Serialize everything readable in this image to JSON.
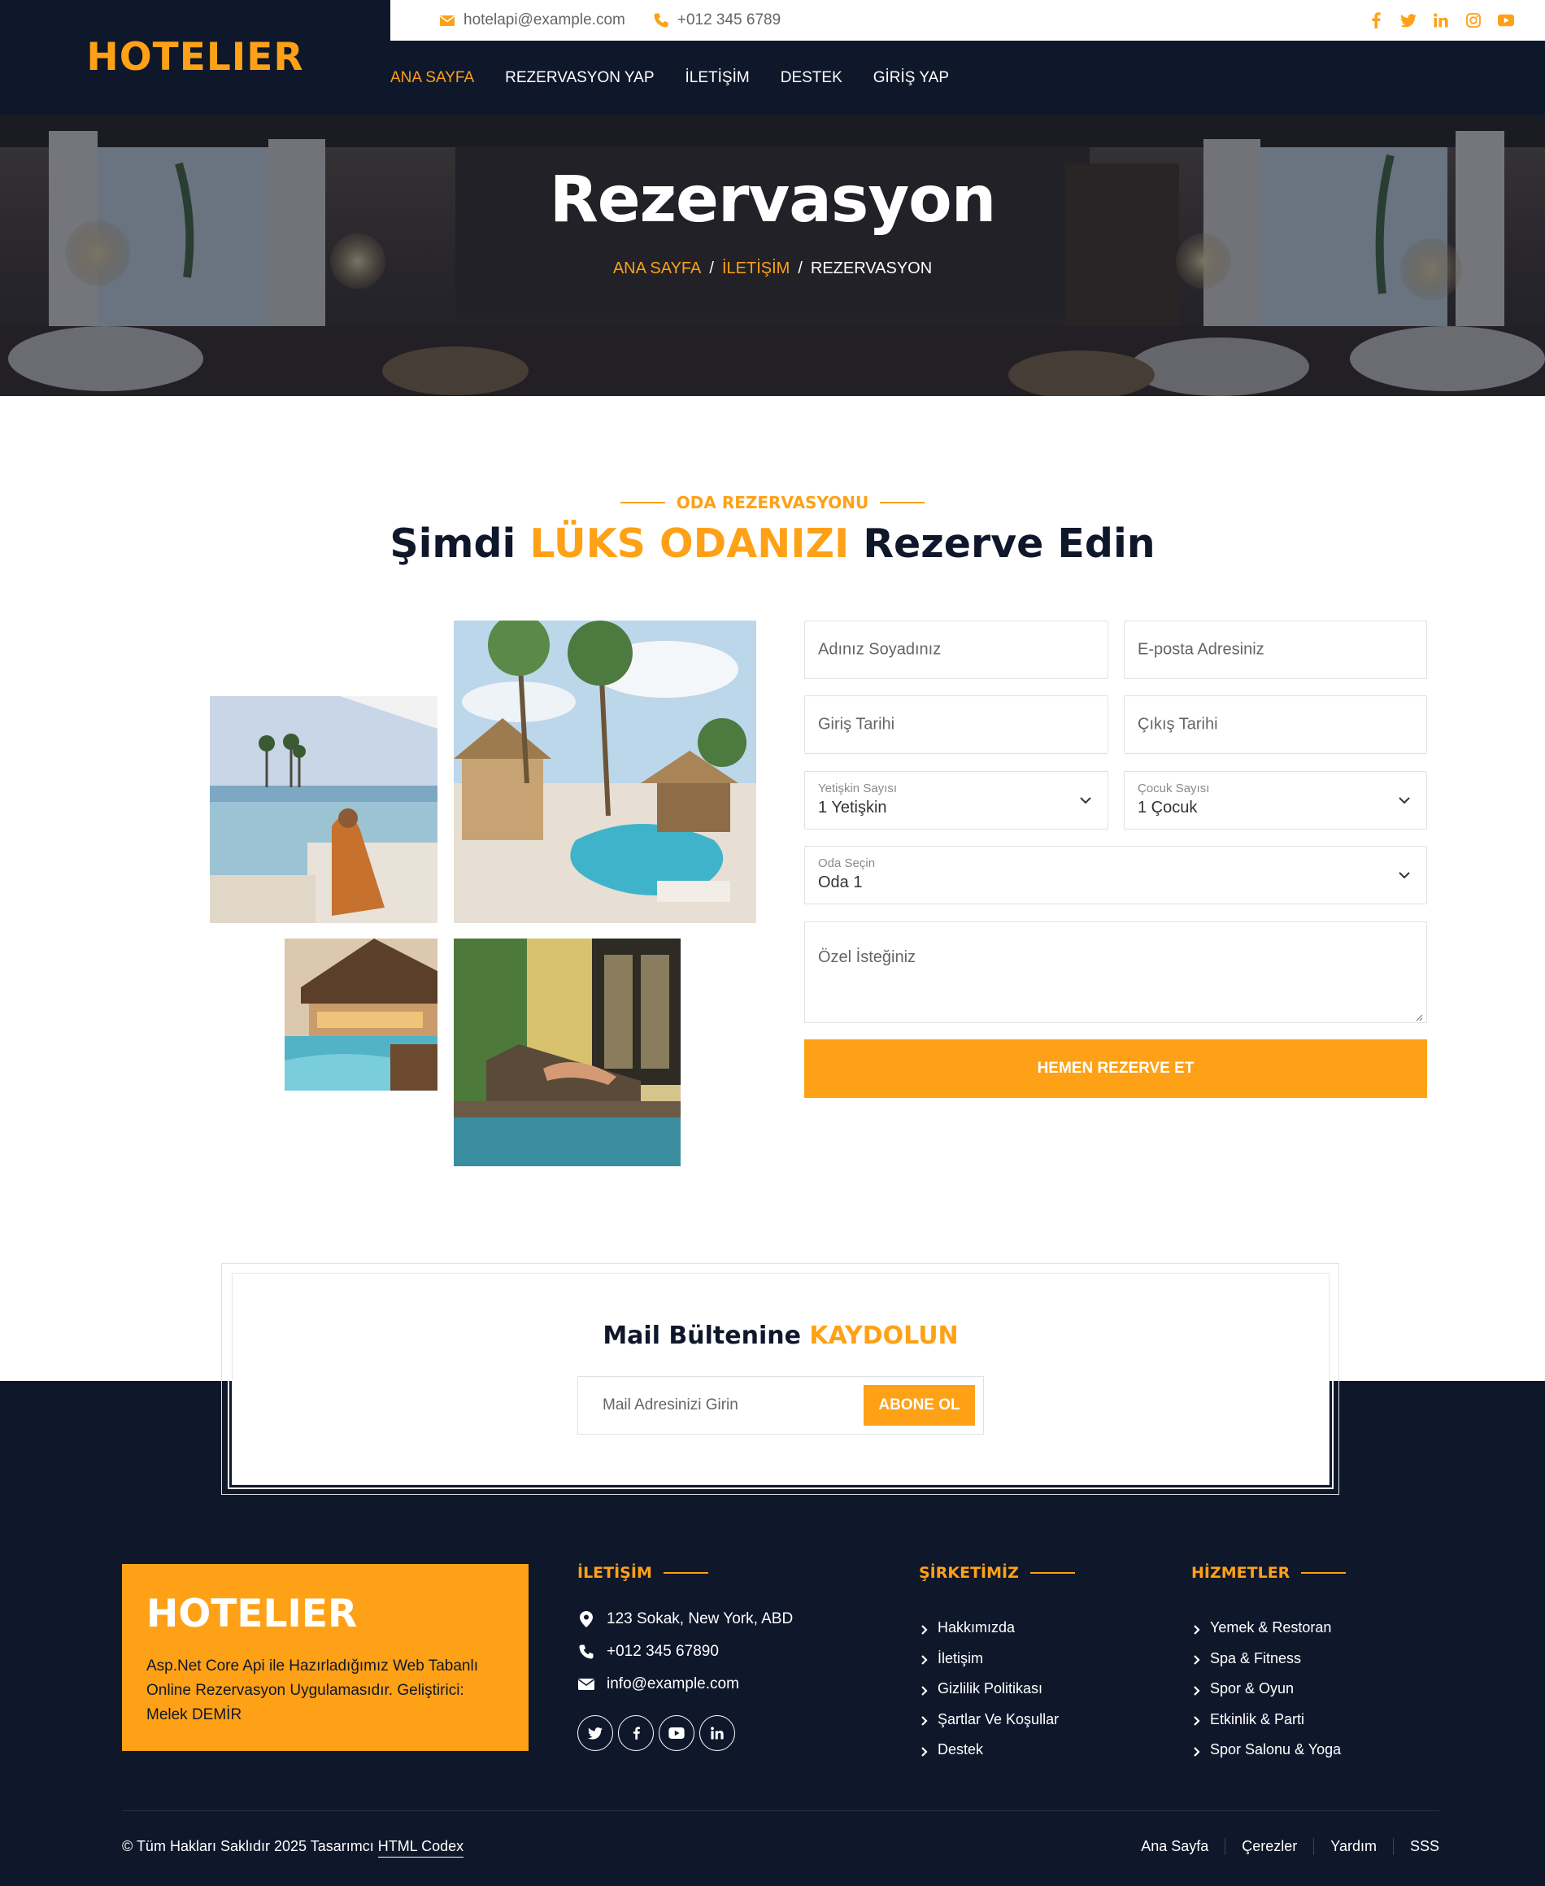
{
  "brand": {
    "logo": "HOTELIER"
  },
  "topbar": {
    "email": "hotelapi@example.com",
    "phone": "+012 345 6789",
    "social_icons": [
      "facebook-icon",
      "twitter-icon",
      "linkedin-icon",
      "instagram-icon",
      "youtube-icon"
    ]
  },
  "nav": {
    "items": [
      {
        "label": "ANA SAYFA"
      },
      {
        "label": "REZERVASYON YAP"
      },
      {
        "label": "İLETİŞİM"
      },
      {
        "label": "DESTEK"
      },
      {
        "label": "GİRİŞ YAP"
      }
    ]
  },
  "hero": {
    "title": "Rezervasyon",
    "breadcrumb": [
      "ANA SAYFA",
      "İLETİŞİM",
      "REZERVASYON"
    ]
  },
  "booking": {
    "subtitle": "ODA REZERVASYONU",
    "title_pre": "Şimdi",
    "title_accent": "LÜKS ODANIZI",
    "title_post": "Rezerve Edin",
    "form": {
      "name_placeholder": "Adınız Soyadınız",
      "email_placeholder": "E-posta Adresiniz",
      "checkin_placeholder": "Giriş Tarihi",
      "checkout_placeholder": "Çıkış Tarihi",
      "adults_label": "Yetişkin Sayısı",
      "adults_value": "1 Yetişkin",
      "children_label": "Çocuk Sayısı",
      "children_value": "1 Çocuk",
      "room_label": "Oda Seçin",
      "room_value": "Oda 1",
      "notes_placeholder": "Özel İsteğiniz",
      "submit_label": "HEMEN REZERVE ET"
    }
  },
  "newsletter": {
    "title_pre": "Mail Bültenine",
    "title_accent": "KAYDOLUN",
    "input_placeholder": "Mail Adresinizi Girin",
    "button_label": "ABONE OL"
  },
  "footer": {
    "brand": {
      "logo": "HOTELIER",
      "description": "Asp.Net Core Api ile Hazırladığımız Web Tabanlı Online Rezervasyon Uygulamasıdır. Geliştirici: Melek DEMİR"
    },
    "contact": {
      "heading": "İLETİŞİM",
      "address": "123 Sokak, New York, ABD",
      "phone": "+012 345 67890",
      "email": "info@example.com",
      "social_icons": [
        "twitter-icon",
        "facebook-icon",
        "youtube-icon",
        "linkedin-icon"
      ]
    },
    "company": {
      "heading": "ŞİRKETİMİZ",
      "links": [
        "Hakkımızda",
        "İletişim",
        "Gizlilik Politikası",
        "Şartlar Ve Koşullar",
        "Destek"
      ]
    },
    "services": {
      "heading": "HİZMETLER",
      "links": [
        "Yemek & Restoran",
        "Spa & Fitness",
        "Spor & Oyun",
        "Etkinlik & Parti",
        "Spor Salonu & Yoga"
      ]
    },
    "copyright_text": "© Tüm Hakları Saklıdır 2025 Tasarımcı",
    "copyright_link": "HTML Codex",
    "bottom_links": [
      "Ana Sayfa",
      "Çerezler",
      "Yardım",
      "SSS"
    ]
  },
  "colors": {
    "primary": "#fea116",
    "dark": "#0f172b",
    "text": "#666565"
  }
}
